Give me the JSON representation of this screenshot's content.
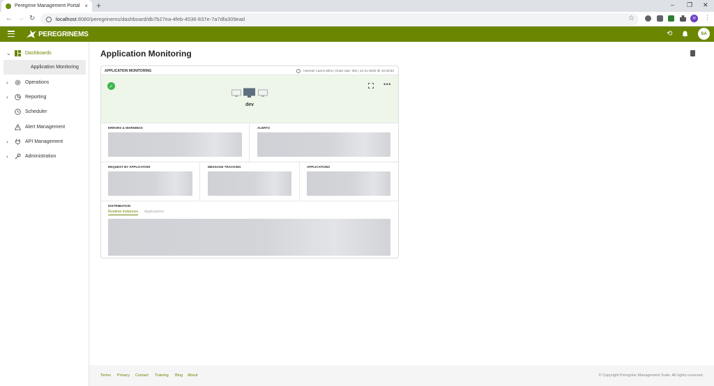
{
  "browser": {
    "tab_title": "Peregrine Management Portal",
    "tab_close": "×",
    "new_tab": "+",
    "url_host": "localhost",
    "url_rest": ":8080/peregrinems/dashboard/db7b27ea-4feb-4536-837e-7a7dfa309ead",
    "profile_initial": "H",
    "window_controls": [
      "–",
      "❐",
      "✕"
    ]
  },
  "app": {
    "brand": "PEREGRINEMS",
    "user_initials": "SA",
    "accent": "#6b8600"
  },
  "sidebar": {
    "items": [
      {
        "label": "Dashboards",
        "expanded": true
      },
      {
        "label": "Operations"
      },
      {
        "label": "Reporting"
      },
      {
        "label": "Scheduler"
      },
      {
        "label": "Alert Management"
      },
      {
        "label": "API Management"
      },
      {
        "label": "Administration"
      }
    ],
    "sub_item": "Application Monitoring"
  },
  "main": {
    "page_title": "Application Monitoring",
    "card": {
      "title": "APPLICATION MONITORING",
      "meta": "Interval: Last 5 Mins  |  Chart rate: 30s  |  12-11-2020 @ 10:30:53",
      "environment": "dev",
      "panels": {
        "errors": "ERRORS & WARNINGS",
        "alerts": "ALERTS",
        "request": "REQUEST BY APPLICATION",
        "message": "MESSAGE TRACKING",
        "applications": "APPLICATIONS",
        "distribution": "DISTRIBUTION"
      },
      "distribution_tabs": [
        "Runtime Instances",
        "Applications"
      ]
    }
  },
  "footer": {
    "links": [
      "Terms",
      "Privacy",
      "Contact",
      "Training",
      "Blog",
      "About"
    ],
    "copyright": "© Copyright Peregrine Management Suite. All rights reserved."
  }
}
